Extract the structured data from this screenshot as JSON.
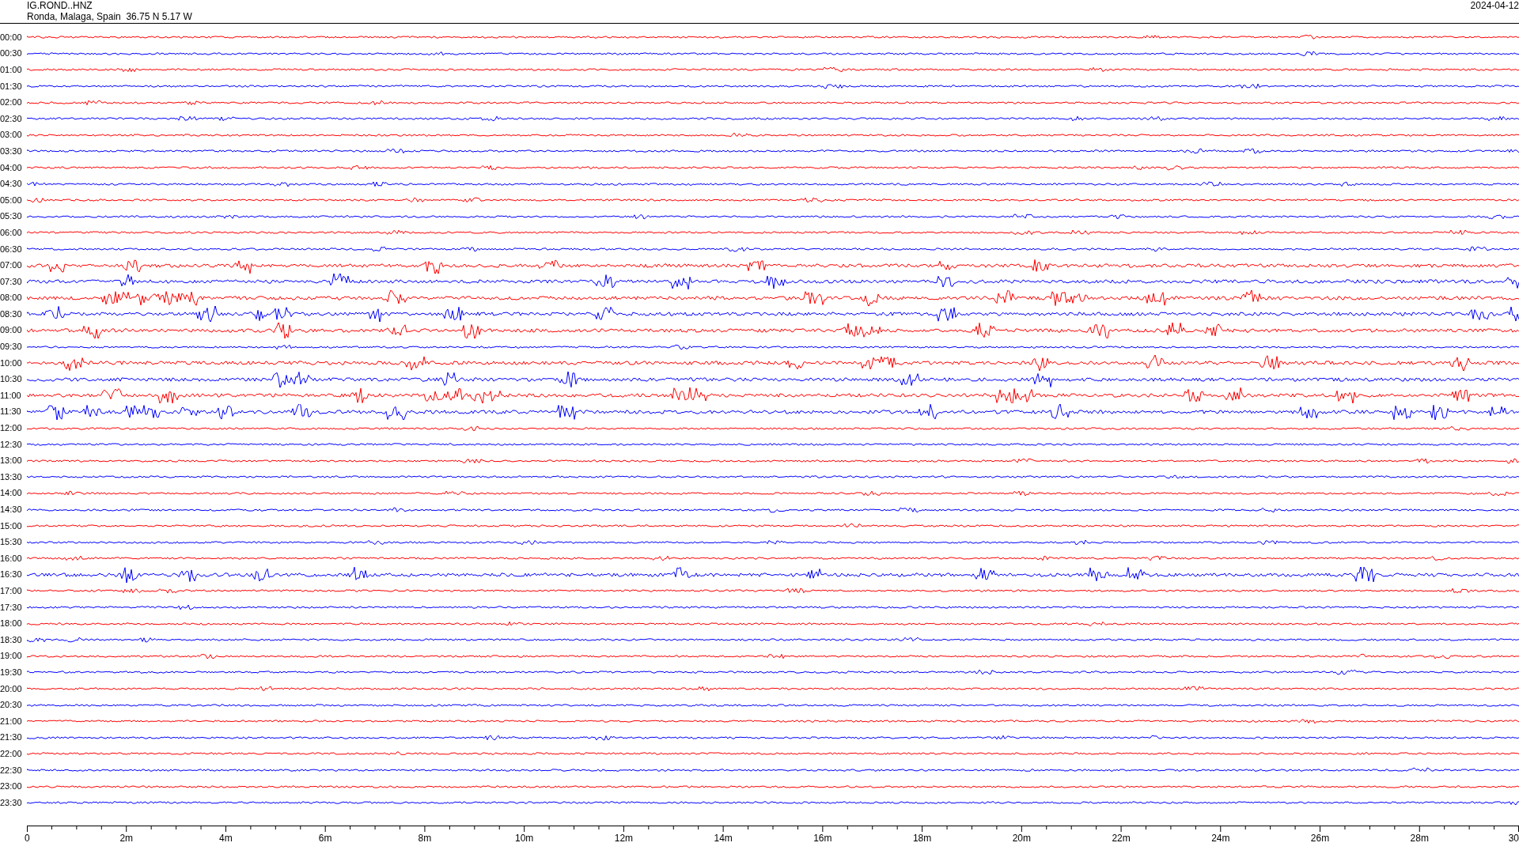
{
  "header": {
    "station": "IG.ROND..HNZ",
    "location": "Ronda, Malaga, Spain  36.75 N 5.17 W",
    "date": "2024-04-12"
  },
  "rows": [
    {
      "time": "00:00",
      "color": "#ff0000",
      "kind": "quiet"
    },
    {
      "time": "00:30",
      "color": "#0000ff",
      "kind": "quiet"
    },
    {
      "time": "01:00",
      "color": "#ff0000",
      "kind": "quiet"
    },
    {
      "time": "01:30",
      "color": "#0000ff",
      "kind": "quiet"
    },
    {
      "time": "02:00",
      "color": "#ff0000",
      "kind": "quiet"
    },
    {
      "time": "02:30",
      "color": "#0000ff",
      "kind": "quiet"
    },
    {
      "time": "03:00",
      "color": "#ff0000",
      "kind": "quiet"
    },
    {
      "time": "03:30",
      "color": "#0000ff",
      "kind": "quiet"
    },
    {
      "time": "04:00",
      "color": "#ff0000",
      "kind": "quiet"
    },
    {
      "time": "04:30",
      "color": "#0000ff",
      "kind": "quiet"
    },
    {
      "time": "05:00",
      "color": "#ff0000",
      "kind": "quiet"
    },
    {
      "time": "05:30",
      "color": "#0000ff",
      "kind": "quiet"
    },
    {
      "time": "06:00",
      "color": "#ff0000",
      "kind": "quiet"
    },
    {
      "time": "06:30",
      "color": "#0000ff",
      "kind": "quiet"
    },
    {
      "time": "07:00",
      "color": "#ff0000",
      "kind": "busy"
    },
    {
      "time": "07:30",
      "color": "#0000ff",
      "kind": "busy"
    },
    {
      "time": "08:00",
      "color": "#ff0000",
      "kind": "busy"
    },
    {
      "time": "08:30",
      "color": "#0000ff",
      "kind": "busy"
    },
    {
      "time": "09:00",
      "color": "#ff0000",
      "kind": "busy"
    },
    {
      "time": "09:30",
      "color": "#0000ff",
      "kind": "quiet"
    },
    {
      "time": "10:00",
      "color": "#ff0000",
      "kind": "busy"
    },
    {
      "time": "10:30",
      "color": "#0000ff",
      "kind": "busy"
    },
    {
      "time": "11:00",
      "color": "#ff0000",
      "kind": "busy"
    },
    {
      "time": "11:30",
      "color": "#0000ff",
      "kind": "busy"
    },
    {
      "time": "12:00",
      "color": "#ff0000",
      "kind": "quiet"
    },
    {
      "time": "12:30",
      "color": "#0000ff",
      "kind": "quiet"
    },
    {
      "time": "13:00",
      "color": "#ff0000",
      "kind": "quiet"
    },
    {
      "time": "13:30",
      "color": "#0000ff",
      "kind": "quiet"
    },
    {
      "time": "14:00",
      "color": "#ff0000",
      "kind": "quiet"
    },
    {
      "time": "14:30",
      "color": "#0000ff",
      "kind": "quiet"
    },
    {
      "time": "15:00",
      "color": "#ff0000",
      "kind": "quiet"
    },
    {
      "time": "15:30",
      "color": "#0000ff",
      "kind": "quiet"
    },
    {
      "time": "16:00",
      "color": "#ff0000",
      "kind": "quiet"
    },
    {
      "time": "16:30",
      "color": "#0000ff",
      "kind": "busy"
    },
    {
      "time": "17:00",
      "color": "#ff0000",
      "kind": "quiet"
    },
    {
      "time": "17:30",
      "color": "#0000ff",
      "kind": "quiet"
    },
    {
      "time": "18:00",
      "color": "#ff0000",
      "kind": "quiet"
    },
    {
      "time": "18:30",
      "color": "#0000ff",
      "kind": "quiet"
    },
    {
      "time": "19:00",
      "color": "#ff0000",
      "kind": "quiet"
    },
    {
      "time": "19:30",
      "color": "#0000ff",
      "kind": "quiet"
    },
    {
      "time": "20:00",
      "color": "#ff0000",
      "kind": "quiet"
    },
    {
      "time": "20:30",
      "color": "#0000ff",
      "kind": "quiet"
    },
    {
      "time": "21:00",
      "color": "#ff0000",
      "kind": "quiet"
    },
    {
      "time": "21:30",
      "color": "#0000ff",
      "kind": "quiet"
    },
    {
      "time": "22:00",
      "color": "#ff0000",
      "kind": "quiet"
    },
    {
      "time": "22:30",
      "color": "#0000ff",
      "kind": "quiet"
    },
    {
      "time": "23:00",
      "color": "#ff0000",
      "kind": "quiet"
    },
    {
      "time": "23:30",
      "color": "#0000ff",
      "kind": "quiet"
    }
  ],
  "x_axis": {
    "labels": [
      "0",
      "2m",
      "4m",
      "6m",
      "8m",
      "10m",
      "12m",
      "14m",
      "16m",
      "18m",
      "20m",
      "22m",
      "24m",
      "26m",
      "28m",
      "30"
    ]
  }
}
